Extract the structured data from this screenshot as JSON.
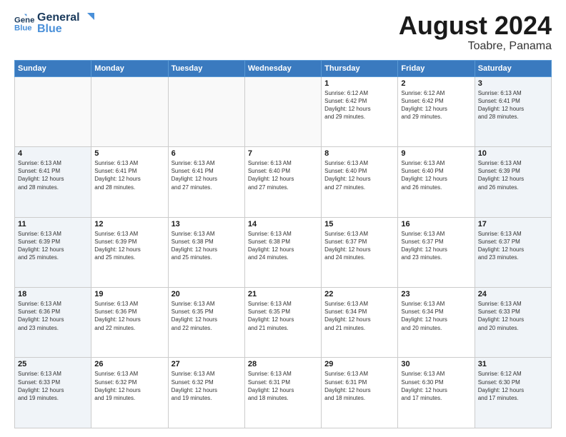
{
  "logo": {
    "line1": "General",
    "line2": "Blue"
  },
  "header": {
    "month": "August 2024",
    "location": "Toabre, Panama"
  },
  "weekdays": [
    "Sunday",
    "Monday",
    "Tuesday",
    "Wednesday",
    "Thursday",
    "Friday",
    "Saturday"
  ],
  "weeks": [
    [
      {
        "day": "",
        "info": ""
      },
      {
        "day": "",
        "info": ""
      },
      {
        "day": "",
        "info": ""
      },
      {
        "day": "",
        "info": ""
      },
      {
        "day": "1",
        "info": "Sunrise: 6:12 AM\nSunset: 6:42 PM\nDaylight: 12 hours\nand 29 minutes."
      },
      {
        "day": "2",
        "info": "Sunrise: 6:12 AM\nSunset: 6:42 PM\nDaylight: 12 hours\nand 29 minutes."
      },
      {
        "day": "3",
        "info": "Sunrise: 6:13 AM\nSunset: 6:41 PM\nDaylight: 12 hours\nand 28 minutes."
      }
    ],
    [
      {
        "day": "4",
        "info": "Sunrise: 6:13 AM\nSunset: 6:41 PM\nDaylight: 12 hours\nand 28 minutes."
      },
      {
        "day": "5",
        "info": "Sunrise: 6:13 AM\nSunset: 6:41 PM\nDaylight: 12 hours\nand 28 minutes."
      },
      {
        "day": "6",
        "info": "Sunrise: 6:13 AM\nSunset: 6:41 PM\nDaylight: 12 hours\nand 27 minutes."
      },
      {
        "day": "7",
        "info": "Sunrise: 6:13 AM\nSunset: 6:40 PM\nDaylight: 12 hours\nand 27 minutes."
      },
      {
        "day": "8",
        "info": "Sunrise: 6:13 AM\nSunset: 6:40 PM\nDaylight: 12 hours\nand 27 minutes."
      },
      {
        "day": "9",
        "info": "Sunrise: 6:13 AM\nSunset: 6:40 PM\nDaylight: 12 hours\nand 26 minutes."
      },
      {
        "day": "10",
        "info": "Sunrise: 6:13 AM\nSunset: 6:39 PM\nDaylight: 12 hours\nand 26 minutes."
      }
    ],
    [
      {
        "day": "11",
        "info": "Sunrise: 6:13 AM\nSunset: 6:39 PM\nDaylight: 12 hours\nand 25 minutes."
      },
      {
        "day": "12",
        "info": "Sunrise: 6:13 AM\nSunset: 6:39 PM\nDaylight: 12 hours\nand 25 minutes."
      },
      {
        "day": "13",
        "info": "Sunrise: 6:13 AM\nSunset: 6:38 PM\nDaylight: 12 hours\nand 25 minutes."
      },
      {
        "day": "14",
        "info": "Sunrise: 6:13 AM\nSunset: 6:38 PM\nDaylight: 12 hours\nand 24 minutes."
      },
      {
        "day": "15",
        "info": "Sunrise: 6:13 AM\nSunset: 6:37 PM\nDaylight: 12 hours\nand 24 minutes."
      },
      {
        "day": "16",
        "info": "Sunrise: 6:13 AM\nSunset: 6:37 PM\nDaylight: 12 hours\nand 23 minutes."
      },
      {
        "day": "17",
        "info": "Sunrise: 6:13 AM\nSunset: 6:37 PM\nDaylight: 12 hours\nand 23 minutes."
      }
    ],
    [
      {
        "day": "18",
        "info": "Sunrise: 6:13 AM\nSunset: 6:36 PM\nDaylight: 12 hours\nand 23 minutes."
      },
      {
        "day": "19",
        "info": "Sunrise: 6:13 AM\nSunset: 6:36 PM\nDaylight: 12 hours\nand 22 minutes."
      },
      {
        "day": "20",
        "info": "Sunrise: 6:13 AM\nSunset: 6:35 PM\nDaylight: 12 hours\nand 22 minutes."
      },
      {
        "day": "21",
        "info": "Sunrise: 6:13 AM\nSunset: 6:35 PM\nDaylight: 12 hours\nand 21 minutes."
      },
      {
        "day": "22",
        "info": "Sunrise: 6:13 AM\nSunset: 6:34 PM\nDaylight: 12 hours\nand 21 minutes."
      },
      {
        "day": "23",
        "info": "Sunrise: 6:13 AM\nSunset: 6:34 PM\nDaylight: 12 hours\nand 20 minutes."
      },
      {
        "day": "24",
        "info": "Sunrise: 6:13 AM\nSunset: 6:33 PM\nDaylight: 12 hours\nand 20 minutes."
      }
    ],
    [
      {
        "day": "25",
        "info": "Sunrise: 6:13 AM\nSunset: 6:33 PM\nDaylight: 12 hours\nand 19 minutes."
      },
      {
        "day": "26",
        "info": "Sunrise: 6:13 AM\nSunset: 6:32 PM\nDaylight: 12 hours\nand 19 minutes."
      },
      {
        "day": "27",
        "info": "Sunrise: 6:13 AM\nSunset: 6:32 PM\nDaylight: 12 hours\nand 19 minutes."
      },
      {
        "day": "28",
        "info": "Sunrise: 6:13 AM\nSunset: 6:31 PM\nDaylight: 12 hours\nand 18 minutes."
      },
      {
        "day": "29",
        "info": "Sunrise: 6:13 AM\nSunset: 6:31 PM\nDaylight: 12 hours\nand 18 minutes."
      },
      {
        "day": "30",
        "info": "Sunrise: 6:13 AM\nSunset: 6:30 PM\nDaylight: 12 hours\nand 17 minutes."
      },
      {
        "day": "31",
        "info": "Sunrise: 6:12 AM\nSunset: 6:30 PM\nDaylight: 12 hours\nand 17 minutes."
      }
    ]
  ],
  "shaded_cols": [
    0,
    6
  ]
}
